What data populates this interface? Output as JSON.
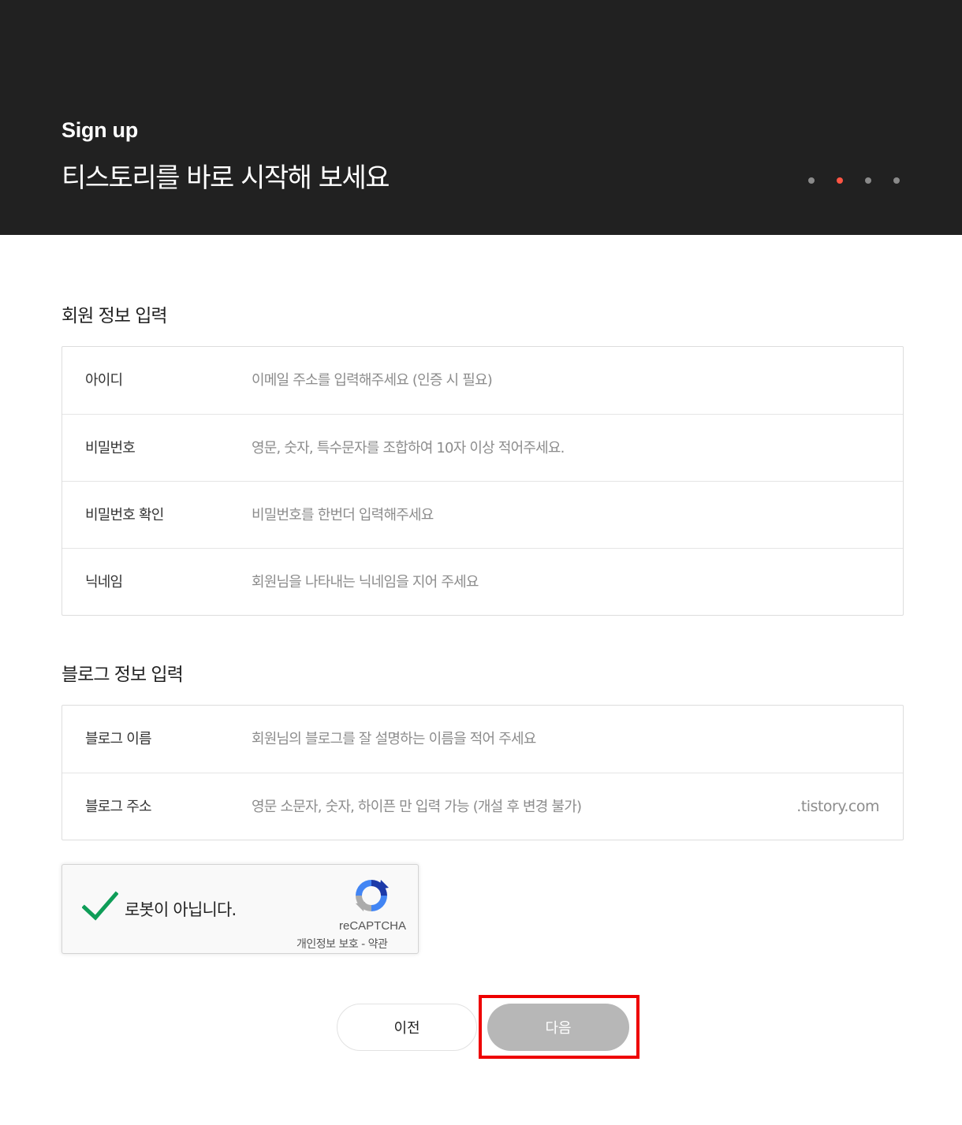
{
  "header": {
    "eyebrow": "Sign up",
    "title": "티스토리를 바로 시작해 보세요",
    "steps": {
      "total": 4,
      "active_index": 1
    },
    "step_active_color": "#ff5544"
  },
  "member_section": {
    "title": "회원 정보 입력",
    "rows": [
      {
        "label": "아이디",
        "placeholder": "이메일 주소를 입력해주세요 (인증 시 필요)"
      },
      {
        "label": "비밀번호",
        "placeholder": "영문, 숫자, 특수문자를 조합하여 10자 이상 적어주세요."
      },
      {
        "label": "비밀번호 확인",
        "placeholder": "비밀번호를 한번더 입력해주세요"
      },
      {
        "label": "닉네임",
        "placeholder": "회원님을 나타내는 닉네임을 지어 주세요"
      }
    ]
  },
  "blog_section": {
    "title": "블로그 정보 입력",
    "rows": [
      {
        "label": "블로그 이름",
        "placeholder": "회원님의 블로그를 잘 설명하는 이름을 적어 주세요"
      },
      {
        "label": "블로그 주소",
        "placeholder": "영문 소문자, 숫자, 하이픈 만 입력 가능 (개설 후 변경 불가)",
        "suffix": ".tistory.com"
      }
    ]
  },
  "captcha": {
    "checked": true,
    "label": "로봇이 아닙니다.",
    "brand": "reCAPTCHA",
    "terms": "개인정보 보호 - 약관",
    "check_color": "#0f9d58"
  },
  "buttons": {
    "prev_label": "이전",
    "next_label": "다음"
  },
  "highlight_color": "#ee0000"
}
